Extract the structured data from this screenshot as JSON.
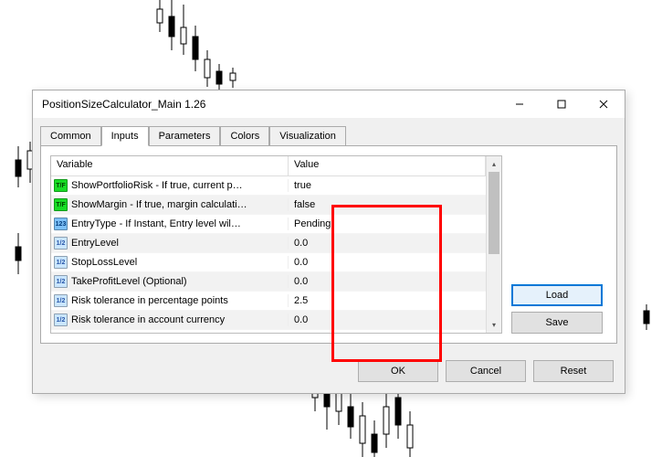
{
  "window": {
    "title": "PositionSizeCalculator_Main 1.26"
  },
  "tabs": {
    "common": "Common",
    "inputs": "Inputs",
    "parameters": "Parameters",
    "colors": "Colors",
    "visualization": "Visualization"
  },
  "grid": {
    "headers": {
      "variable": "Variable",
      "value": "Value"
    },
    "rows": [
      {
        "icon": "bool",
        "label": "ShowPortfolioRisk - If true, current p…",
        "value": "true"
      },
      {
        "icon": "bool",
        "label": "ShowMargin - If true, margin calculati…",
        "value": "false"
      },
      {
        "icon": "enum",
        "label": "EntryType - If Instant, Entry level wil…",
        "value": "Pending"
      },
      {
        "icon": "num",
        "label": "EntryLevel",
        "value": "0.0"
      },
      {
        "icon": "num",
        "label": "StopLossLevel",
        "value": "0.0"
      },
      {
        "icon": "num",
        "label": "TakeProfitLevel (Optional)",
        "value": "0.0"
      },
      {
        "icon": "num",
        "label": "Risk tolerance in percentage points",
        "value": "2.5"
      },
      {
        "icon": "num",
        "label": "Risk tolerance in account currency",
        "value": "0.0"
      }
    ]
  },
  "buttons": {
    "load": "Load",
    "save": "Save",
    "ok": "OK",
    "cancel": "Cancel",
    "reset": "Reset"
  },
  "icon_text": {
    "bool": "T/F",
    "enum": "123",
    "num": "1/2"
  }
}
